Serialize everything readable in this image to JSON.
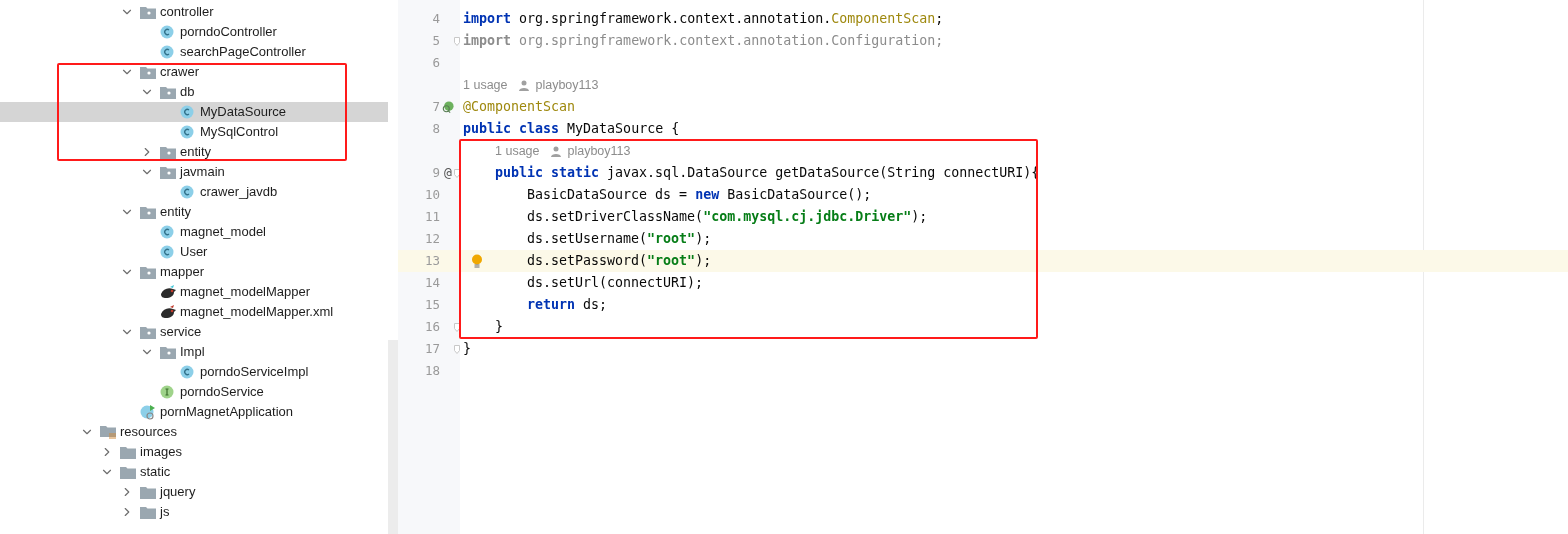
{
  "project_tree": {
    "package_children": [
      {
        "label": "controller",
        "kind": "package",
        "expanded": true,
        "selected": false,
        "children": [
          {
            "label": "porndoController",
            "kind": "class",
            "selected": false
          },
          {
            "label": "searchPageController",
            "kind": "class",
            "selected": false
          }
        ]
      },
      {
        "label": "crawer",
        "kind": "package",
        "expanded": true,
        "selected": false,
        "children": [
          {
            "label": "db",
            "kind": "package",
            "expanded": true,
            "selected": false,
            "children": [
              {
                "label": "MyDataSource",
                "kind": "class",
                "selected": true
              },
              {
                "label": "MySqlControl",
                "kind": "class",
                "selected": false
              }
            ]
          },
          {
            "label": "entity",
            "kind": "package",
            "expanded": false,
            "selected": false
          },
          {
            "label": "javmain",
            "kind": "package",
            "expanded": true,
            "selected": false,
            "children": [
              {
                "label": "crawer_javdb",
                "kind": "class",
                "selected": false
              }
            ]
          }
        ]
      },
      {
        "label": "entity",
        "kind": "package",
        "expanded": true,
        "selected": false,
        "children": [
          {
            "label": "magnet_model",
            "kind": "class",
            "selected": false
          },
          {
            "label": "User",
            "kind": "class",
            "selected": false
          }
        ]
      },
      {
        "label": "mapper",
        "kind": "package",
        "expanded": true,
        "selected": false,
        "children": [
          {
            "label": "magnet_modelMapper",
            "kind": "mapper",
            "selected": false
          },
          {
            "label": "magnet_modelMapper.xml",
            "kind": "mapper-xml",
            "selected": false
          }
        ]
      },
      {
        "label": "service",
        "kind": "package",
        "expanded": true,
        "selected": false,
        "children": [
          {
            "label": "Impl",
            "kind": "package",
            "expanded": true,
            "selected": false,
            "children": [
              {
                "label": "porndoServiceImpl",
                "kind": "class",
                "selected": false
              }
            ]
          },
          {
            "label": "porndoService",
            "kind": "interface",
            "selected": false
          }
        ]
      },
      {
        "label": "pornMagnetApplication",
        "kind": "application",
        "selected": false
      }
    ],
    "source_roots": [
      {
        "label": "resources",
        "kind": "resources",
        "expanded": true,
        "selected": false,
        "children": [
          {
            "label": "images",
            "kind": "folder",
            "expanded": false,
            "selected": false
          },
          {
            "label": "static",
            "kind": "folder",
            "expanded": true,
            "selected": false,
            "children": [
              {
                "label": "jquery",
                "kind": "folder",
                "expanded": false,
                "selected": false
              },
              {
                "label": "js",
                "kind": "folder",
                "expanded": false,
                "selected": false
              }
            ]
          }
        ]
      }
    ]
  },
  "editor": {
    "lines": [
      {
        "kind": "code",
        "number": "4",
        "current": false,
        "tokens": [
          {
            "text": "import",
            "kind": "keyword"
          },
          {
            "text": " org.springframework.context.annotation.",
            "kind": "plain"
          },
          {
            "text": "ComponentScan",
            "kind": "annotation"
          },
          {
            "text": ";",
            "kind": "plain"
          }
        ]
      },
      {
        "kind": "code",
        "number": "5",
        "current": false,
        "fold": true,
        "tokens": [
          {
            "text": "import",
            "kind": "unused-keyword"
          },
          {
            "text": " org.springframework.context.annotation.Configuration;",
            "kind": "unused"
          }
        ]
      },
      {
        "kind": "code",
        "number": "6",
        "current": false
      },
      {
        "kind": "inlay",
        "usages": "1 usage",
        "author": "playboy113"
      },
      {
        "kind": "code",
        "number": "7",
        "current": false,
        "bean_marker": true,
        "tokens": [
          {
            "text": "@ComponentScan",
            "kind": "annotation"
          }
        ]
      },
      {
        "kind": "code",
        "number": "8",
        "current": false,
        "tokens": [
          {
            "text": "public class",
            "kind": "keyword"
          },
          {
            "text": " MyDataSource {",
            "kind": "plain"
          }
        ],
        "children": [
          {
            "kind": "inlay",
            "usages": "1 usage",
            "author": "playboy113"
          },
          {
            "kind": "code",
            "number": "9",
            "current": false,
            "gutter_text": "@",
            "fold": true,
            "tokens": [
              {
                "text": "public static",
                "kind": "keyword"
              },
              {
                "text": " javax.sql.DataSource getDataSource(String connectURI){",
                "kind": "plain"
              }
            ],
            "children": [
              {
                "kind": "code",
                "number": "10",
                "current": false,
                "tokens": [
                  {
                    "text": "BasicDataSource ds = ",
                    "kind": "plain"
                  },
                  {
                    "text": "new",
                    "kind": "keyword"
                  },
                  {
                    "text": " BasicDataSource();",
                    "kind": "plain"
                  }
                ]
              },
              {
                "kind": "code",
                "number": "11",
                "current": false,
                "tokens": [
                  {
                    "text": "ds.setDriverClassName(",
                    "kind": "plain"
                  },
                  {
                    "text": "\"com.mysql.cj.jdbc.Driver\"",
                    "kind": "string"
                  },
                  {
                    "text": ");",
                    "kind": "plain"
                  }
                ]
              },
              {
                "kind": "code",
                "number": "12",
                "current": false,
                "tokens": [
                  {
                    "text": "ds.setUsername(",
                    "kind": "plain"
                  },
                  {
                    "text": "\"root\"",
                    "kind": "string"
                  },
                  {
                    "text": ");",
                    "kind": "plain"
                  }
                ]
              },
              {
                "kind": "code",
                "number": "13",
                "current": true,
                "bulb": true,
                "tokens": [
                  {
                    "text": "ds.setPassword(",
                    "kind": "plain"
                  },
                  {
                    "text": "\"root\"",
                    "kind": "string"
                  },
                  {
                    "text": ");",
                    "kind": "plain"
                  }
                ]
              },
              {
                "kind": "code",
                "number": "14",
                "current": false,
                "tokens": [
                  {
                    "text": "ds.setUrl(connectURI);",
                    "kind": "plain"
                  }
                ]
              },
              {
                "kind": "code",
                "number": "15",
                "current": false,
                "tokens": [
                  {
                    "text": "return",
                    "kind": "keyword"
                  },
                  {
                    "text": " ds;",
                    "kind": "plain"
                  }
                ]
              }
            ]
          },
          {
            "kind": "code",
            "number": "16",
            "current": false,
            "fold": true,
            "tokens": [
              {
                "text": "}",
                "kind": "plain"
              }
            ]
          }
        ]
      },
      {
        "kind": "code",
        "number": "17",
        "current": false,
        "fold": true,
        "tokens": [
          {
            "text": "}",
            "kind": "plain"
          }
        ]
      },
      {
        "kind": "code",
        "number": "18",
        "current": false
      }
    ]
  }
}
